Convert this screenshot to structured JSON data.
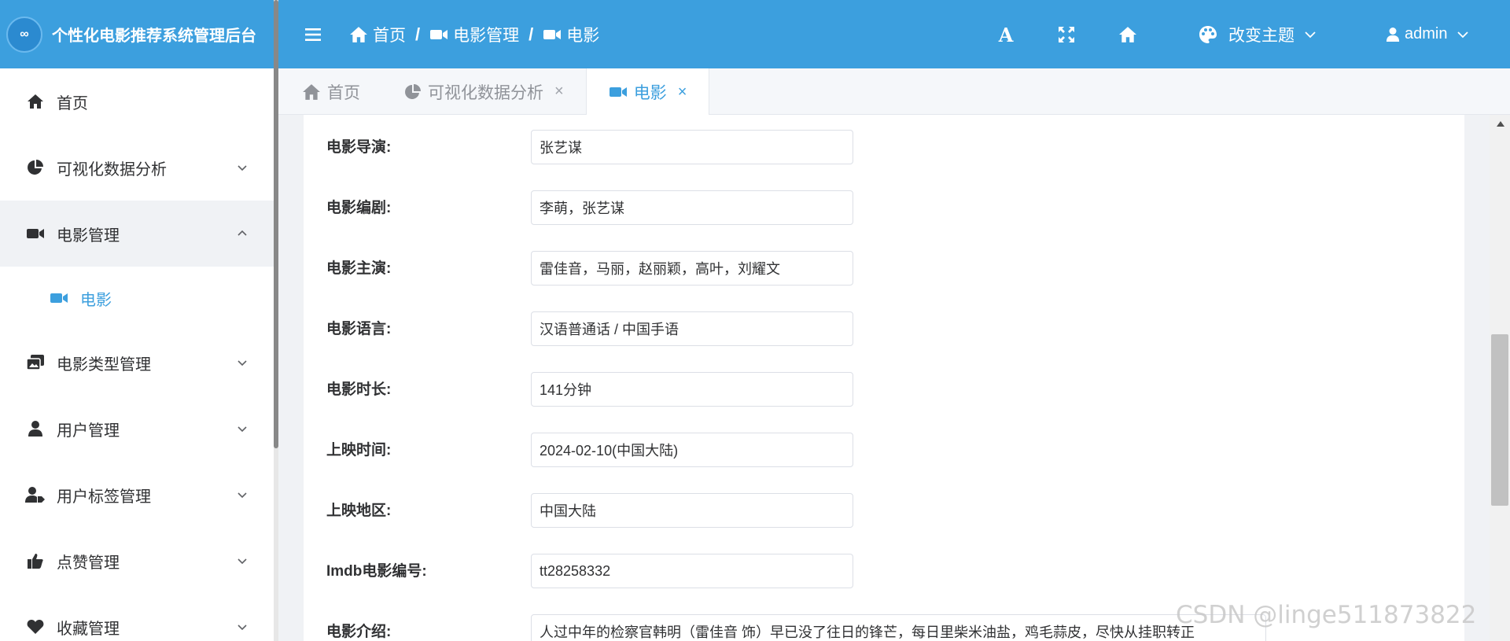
{
  "brand": {
    "logo_text": "∞",
    "title": "个性化电影推荐系统管理后台"
  },
  "sidebar": {
    "items": [
      {
        "label": "首页"
      },
      {
        "label": "可视化数据分析"
      },
      {
        "label": "电影管理"
      },
      {
        "label": "电影"
      },
      {
        "label": "电影类型管理"
      },
      {
        "label": "用户管理"
      },
      {
        "label": "用户标签管理"
      },
      {
        "label": "点赞管理"
      },
      {
        "label": "收藏管理"
      }
    ]
  },
  "header": {
    "breadcrumb": [
      "首页",
      "电影管理",
      "电影"
    ],
    "separator": "/",
    "font_icon": "A",
    "theme_label": "改变主题",
    "user_label": "admin"
  },
  "tabs": [
    {
      "label": "首页"
    },
    {
      "label": "可视化数据分析",
      "close": "×"
    },
    {
      "label": "电影",
      "close": "×"
    }
  ],
  "form": {
    "rows": [
      {
        "label": "电影导演:",
        "value": "张艺谋"
      },
      {
        "label": "电影编剧:",
        "value": "李萌，张艺谋"
      },
      {
        "label": "电影主演:",
        "value": "雷佳音，马丽，赵丽颖，高叶，刘耀文"
      },
      {
        "label": "电影语言:",
        "value": "汉语普通话 / 中国手语"
      },
      {
        "label": "电影时长:",
        "value": "141分钟"
      },
      {
        "label": "上映时间:",
        "value": "2024-02-10(中国大陆)"
      },
      {
        "label": "上映地区:",
        "value": "中国大陆"
      },
      {
        "label": "Imdb电影编号:",
        "value": "tt28258332"
      },
      {
        "label": "电影介绍:",
        "value": "人过中年的检察官韩明（雷佳音 饰）早已没了往日的锋芒，每日里柴米油盐，鸡毛蒜皮，尽快从挂职转正"
      }
    ]
  },
  "watermark": "CSDN @linge511873822",
  "colors": {
    "primary": "#3c9fde",
    "sidebar_bg": "#ffffff",
    "active_bg": "#f0f2f5"
  }
}
